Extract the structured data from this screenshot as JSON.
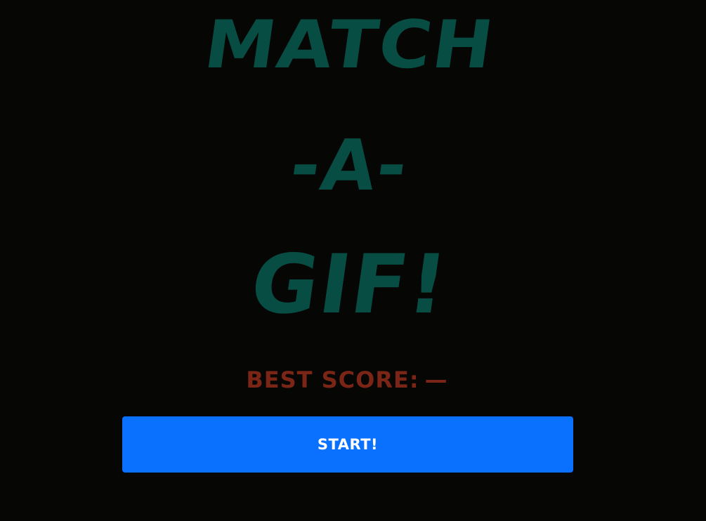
{
  "title": {
    "line1": "MATCH",
    "line2": "-A-",
    "line3": "GIF!"
  },
  "best_score": {
    "label": "BEST SCORE:",
    "value": "—"
  },
  "start_button": {
    "label": "START!"
  },
  "colors": {
    "background": "#060605",
    "title": "#074d43",
    "best_score": "#7a2516",
    "button": "#0a71ff",
    "button_text": "#ffffff"
  }
}
